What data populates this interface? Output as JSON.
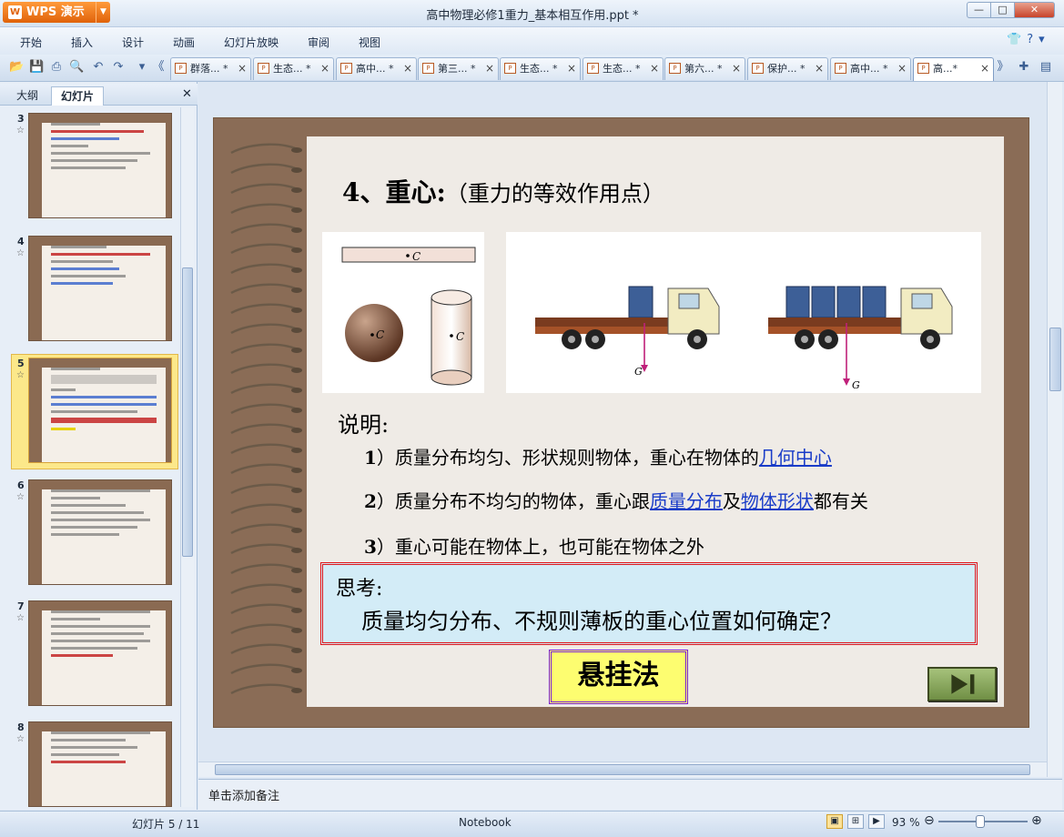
{
  "app": {
    "name": "WPS 演示",
    "window_title": "高中物理必修1重力_基本相互作用.ppt *"
  },
  "menu": [
    "开始",
    "插入",
    "设计",
    "动画",
    "幻灯片放映",
    "审阅",
    "视图"
  ],
  "doc_tabs": [
    "群落... *",
    "生态... *",
    "高中... *",
    "第三... *",
    "生态... *",
    "生态... *",
    "第六... *",
    "保护... *",
    "高中... *",
    "高...*"
  ],
  "panel": {
    "tab_outline": "大纲",
    "tab_slides": "幻灯片",
    "thumbnails": [
      {
        "num": "3"
      },
      {
        "num": "4"
      },
      {
        "num": "5"
      },
      {
        "num": "6"
      },
      {
        "num": "7"
      },
      {
        "num": "8"
      }
    ],
    "selected": "5"
  },
  "slide": {
    "title_main": "4、重心:",
    "title_sub": "（重力的等效作用点）",
    "image_labels": {
      "c": "C",
      "g": "G"
    },
    "explanation_label": "说明:",
    "points": [
      {
        "num": "1",
        "pre": "）质量分布均匀、形状规则物体，重心在物体的",
        "link1": "几何中心",
        "mid": "",
        "link2": "",
        "post": ""
      },
      {
        "num": "2",
        "pre": "）质量分布不均匀的物体，重心跟",
        "link1": "质量分布",
        "mid": "及",
        "link2": "物体形状",
        "post": "都有关"
      },
      {
        "num": "3",
        "pre": "）重心可能在物体上，也可能在物体之外",
        "link1": "",
        "mid": "",
        "link2": "",
        "post": ""
      }
    ],
    "think_label": "思考:",
    "think_question": "质量均匀分布、不规则薄板的重心位置如何确定？",
    "answer": "悬挂法"
  },
  "notes_placeholder": "单击添加备注",
  "status": {
    "slide_counter": "幻灯片 5 / 11",
    "theme": "Notebook",
    "zoom": "93 %"
  },
  "colors": {
    "accent_orange": "#e0620a",
    "link_blue": "#1a3cc8",
    "think_border": "#e0141a",
    "answer_border": "#7a1dd8",
    "answer_fill": "#fdfd70"
  }
}
